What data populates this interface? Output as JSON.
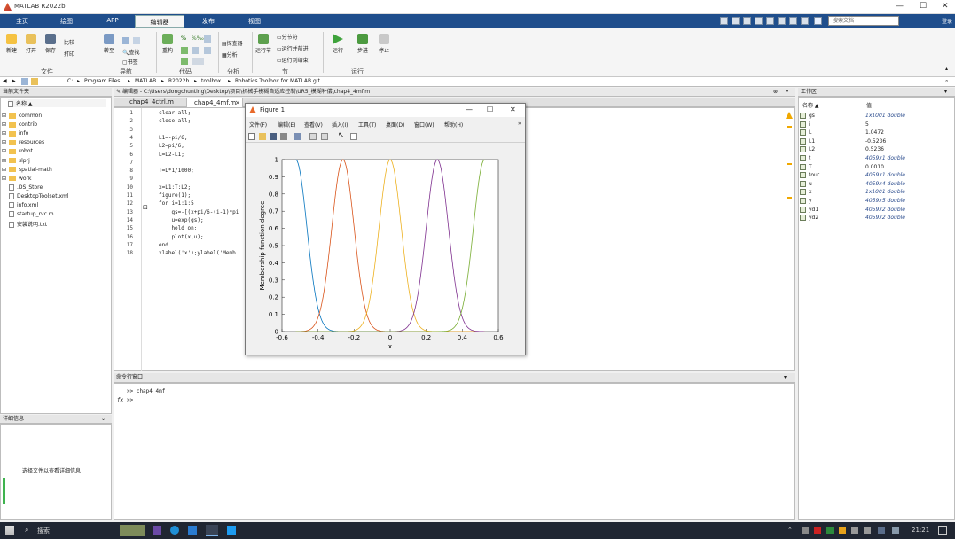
{
  "app": {
    "title": "MATLAB R2022b"
  },
  "main_tabs": [
    "主页",
    "绘图",
    "APP",
    "编辑器",
    "发布",
    "视图"
  ],
  "active_tab": "编辑器",
  "search": {
    "placeholder": "搜索文档"
  },
  "login": "登录",
  "toolstrip": {
    "groups": [
      "文件",
      "导航",
      "代码",
      "分析",
      "节",
      "运行"
    ],
    "file": {
      "new": "新建",
      "open": "打开",
      "save": "保存",
      "compare": "比较",
      "print": "打印"
    },
    "nav": {
      "goto": "转至",
      "find": "查找",
      "bookmark": "书签"
    },
    "code": {
      "refactor": "重构"
    },
    "analysis": {
      "profile": "探查器",
      "analyze": "分析"
    },
    "section": {
      "run_section": "运行节",
      "section_break": "分节符",
      "run_advance": "运行并前进",
      "run_to_end": "运行到结束"
    },
    "run": {
      "run": "运行",
      "step": "步进",
      "stop": "停止"
    }
  },
  "address": {
    "parts": [
      "C:",
      "Program Files",
      "MATLAB",
      "R2022b",
      "toolbox",
      "Robotics Toolbox for MATLAB git"
    ]
  },
  "current_folder": {
    "title": "当前文件夹",
    "col_name": "名称 ▲",
    "items": [
      {
        "name": "common",
        "type": "folder"
      },
      {
        "name": "contrib",
        "type": "folder"
      },
      {
        "name": "info",
        "type": "folder"
      },
      {
        "name": "resources",
        "type": "folder"
      },
      {
        "name": "robot",
        "type": "folder"
      },
      {
        "name": "slprj",
        "type": "folder"
      },
      {
        "name": "spatial-math",
        "type": "folder"
      },
      {
        "name": "work",
        "type": "folder"
      },
      {
        "name": ".DS_Store",
        "type": "file"
      },
      {
        "name": "DesktopToolset.xml",
        "type": "file"
      },
      {
        "name": "info.xml",
        "type": "file"
      },
      {
        "name": "startup_rvc.m",
        "type": "file"
      },
      {
        "name": "安装说明.txt",
        "type": "file"
      }
    ]
  },
  "details": {
    "title": "详细信息",
    "message": "选择文件以查看详细信息"
  },
  "editor": {
    "header": "编辑器 - C:\\Users\\dongchunting\\Desktop\\项目\\机械手模糊自适应控制\\UR5_模糊补偿\\chap4_4mf.m",
    "tabs": [
      "chap4_4ctrl.m",
      "chap4_4mf.m"
    ],
    "lines": [
      "clear all;",
      "close all;",
      "",
      "L1=-pi/6;",
      "L2=pi/6;",
      "L=L2-L1;",
      "",
      "T=L*1/1000;",
      "",
      "x=L1:T:L2;",
      "figure(1);",
      "for i=1:1:5",
      "    gs=-[(x+pi/6-(i-1)*pi",
      "    u=exp(gs);",
      "    hold on;",
      "    plot(x,u);",
      "end",
      "xlabel('x');ylabel('Memb"
    ]
  },
  "command_window": {
    "title": "命令行窗口",
    "history": ">> chap4_4mf",
    "prompt": ">>",
    "fx": "fx"
  },
  "workspace": {
    "title": "工作区",
    "col_name": "名称 ▲",
    "col_value": "值",
    "vars": [
      {
        "name": "gs",
        "value": "1x1001 double",
        "italic": true
      },
      {
        "name": "i",
        "value": "5",
        "italic": false
      },
      {
        "name": "L",
        "value": "1.0472",
        "italic": false
      },
      {
        "name": "L1",
        "value": "-0.5236",
        "italic": false
      },
      {
        "name": "L2",
        "value": "0.5236",
        "italic": false
      },
      {
        "name": "t",
        "value": "4059x1 double",
        "italic": true
      },
      {
        "name": "T",
        "value": "0.0010",
        "italic": false
      },
      {
        "name": "tout",
        "value": "4059x1 double",
        "italic": true
      },
      {
        "name": "u",
        "value": "4059x4 double",
        "italic": true
      },
      {
        "name": "x",
        "value": "1x1001 double",
        "italic": true
      },
      {
        "name": "y",
        "value": "4059x5 double",
        "italic": true
      },
      {
        "name": "yd1",
        "value": "4059x2 double",
        "italic": true
      },
      {
        "name": "yd2",
        "value": "4059x2 double",
        "italic": true
      }
    ]
  },
  "figure": {
    "title": "Figure 1",
    "menu": [
      "文件(F)",
      "编辑(E)",
      "查看(V)",
      "插入(I)",
      "工具(T)",
      "桌面(D)",
      "窗口(W)",
      "帮助(H)"
    ]
  },
  "chart_data": {
    "type": "line",
    "xlabel": "x",
    "ylabel": "Membership function degree",
    "xlim": [
      -0.6,
      0.6
    ],
    "ylim": [
      0,
      1
    ],
    "xticks": [
      "-0.6",
      "-0.4",
      "-0.2",
      "0",
      "0.2",
      "0.4",
      "0.6"
    ],
    "yticks": [
      "0",
      "0.1",
      "0.2",
      "0.3",
      "0.4",
      "0.5",
      "0.6",
      "0.7",
      "0.8",
      "0.9",
      "1"
    ],
    "x_range": [
      -0.5236,
      0.5236
    ],
    "series": [
      {
        "center": -0.5236,
        "color": "#0072BD"
      },
      {
        "center": -0.2618,
        "color": "#D95319"
      },
      {
        "center": 0.0,
        "color": "#EDB120"
      },
      {
        "center": 0.2618,
        "color": "#7E2F8E"
      },
      {
        "center": 0.5236,
        "color": "#77AC30"
      }
    ]
  },
  "taskbar": {
    "search": "搜索",
    "time": "21:21"
  }
}
